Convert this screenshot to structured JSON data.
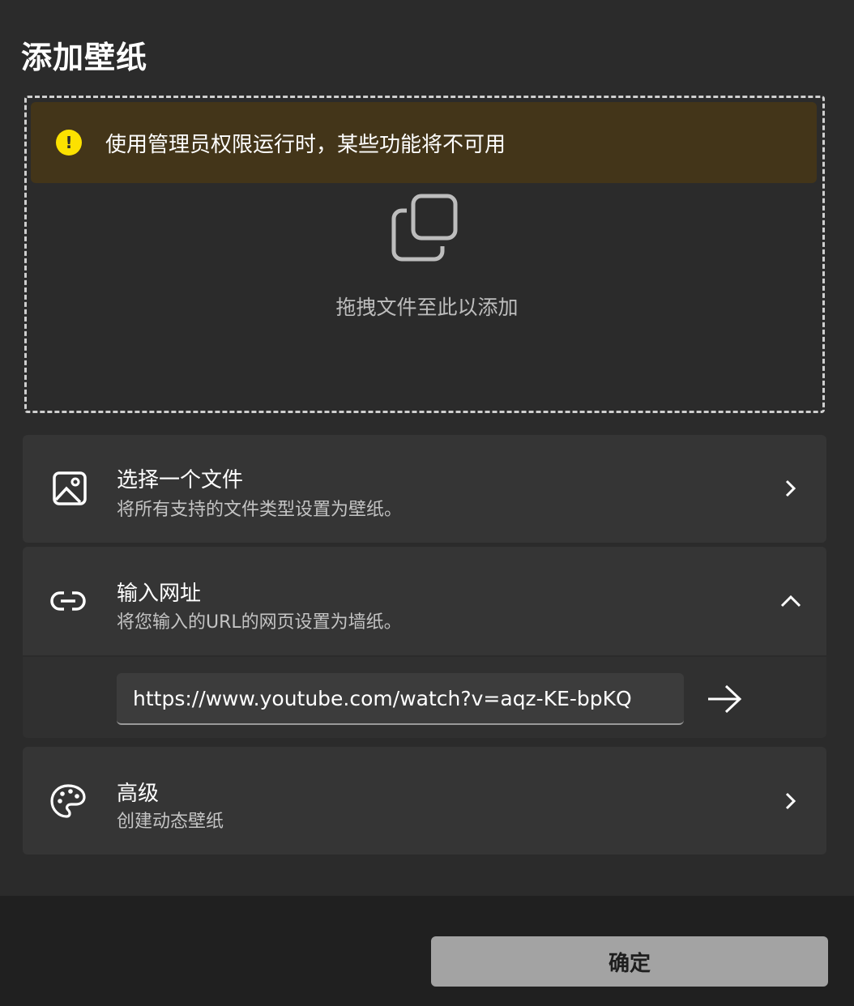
{
  "dialog": {
    "title": "添加壁纸"
  },
  "infobar": {
    "message": "使用管理员权限运行时，某些功能将不可用"
  },
  "dropzone": {
    "label": "拖拽文件至此以添加"
  },
  "choose_file": {
    "title": "选择一个文件",
    "subtitle": "将所有支持的文件类型设置为壁纸。"
  },
  "enter_url": {
    "title": "输入网址",
    "subtitle": "将您输入的URL的网页设置为墙纸。",
    "value": "https://www.youtube.com/watch?v=aqz-KE-bpKQ"
  },
  "advanced": {
    "title": "高级",
    "subtitle": "创建动态壁纸"
  },
  "footer": {
    "ok_label": "确定"
  },
  "icons": {
    "warning": "warning-icon",
    "copy": "copy-icon",
    "image": "image-icon",
    "link": "link-icon",
    "palette": "palette-icon",
    "chevron_right": "chevron-right-icon",
    "chevron_up": "chevron-up-icon",
    "arrow_right": "arrow-right-icon"
  },
  "colors": {
    "background": "#2b2b2b",
    "card": "#353535",
    "infobar": "#433519",
    "warning": "#fce100",
    "button": "#a3a3a3"
  }
}
